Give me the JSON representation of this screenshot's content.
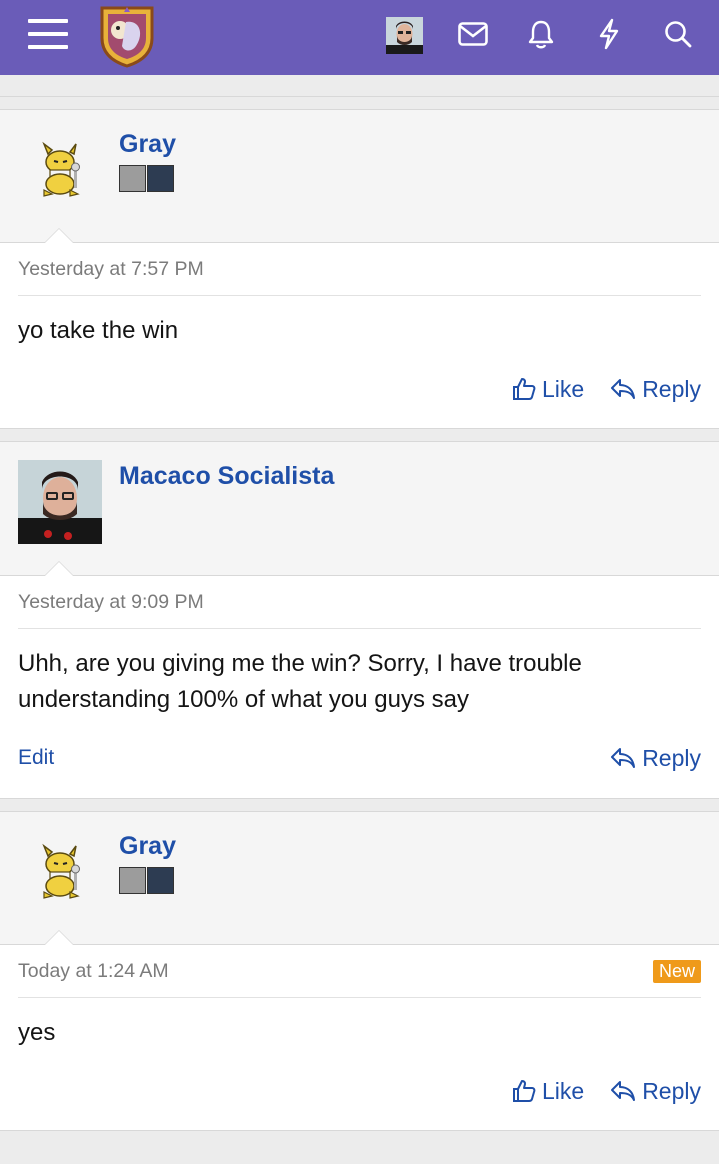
{
  "header": {
    "icons": [
      "menu-icon",
      "mail-icon",
      "bell-icon",
      "bolt-icon",
      "search-icon"
    ],
    "accent": "#6a5cb8"
  },
  "posts": [
    {
      "username": "Gray",
      "time": "Yesterday at 7:57 PM",
      "message": "yo take the win",
      "like_label": "Like",
      "reply_label": "Reply"
    },
    {
      "username": "Macaco Socialista",
      "time": "Yesterday at 9:09 PM",
      "message": "Uhh, are you giving me the win? Sorry, I have trouble understanding 100% of what you guys say",
      "edit_label": "Edit",
      "reply_label": "Reply"
    },
    {
      "username": "Gray",
      "time": "Today at 1:24 AM",
      "new_label": "New",
      "message": "yes",
      "like_label": "Like",
      "reply_label": "Reply"
    }
  ],
  "colors": {
    "link": "#1f4fa8",
    "meta": "#7b7b7b",
    "new_badge": "#ef9a1a"
  }
}
